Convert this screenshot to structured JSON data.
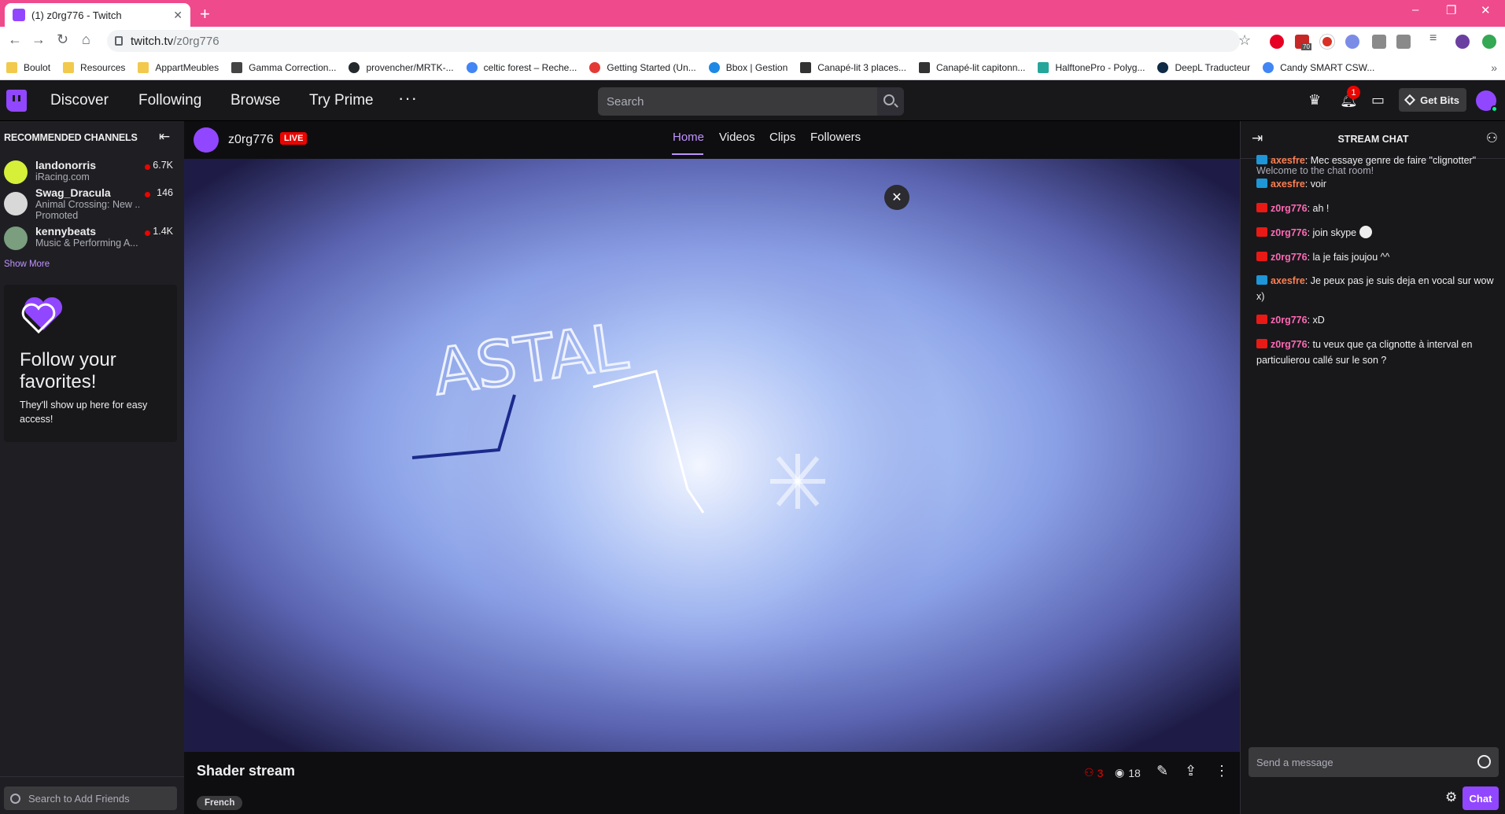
{
  "browser": {
    "tab_title": "(1) z0rg776 - Twitch",
    "tab_close": "✕",
    "new_tab": "+",
    "window_controls": [
      "–",
      "❐",
      "✕"
    ],
    "url_host": "twitch.tv",
    "url_path": "/z0rg776",
    "bookmarks": [
      "Boulot",
      "Resources",
      "AppartMeubles",
      "Gamma Correction...",
      "provencher/MRTK-...",
      "celtic forest – Reche...",
      "Getting Started (Un...",
      "Bbox | Gestion",
      "Canapé-lit 3 places...",
      "Canapé-lit capitonn...",
      "HalftonePro - Polyg...",
      "DeepL Traducteur",
      "Candy SMART CSW..."
    ],
    "ext_badge": "70"
  },
  "nav": {
    "discover": "Discover",
    "following": "Following",
    "browse": "Browse",
    "try_prime": "Try Prime",
    "more": "···",
    "search_placeholder": "Search",
    "notif_count": "1",
    "get_bits": "Get Bits"
  },
  "sidebar": {
    "title": "RECOMMENDED CHANNELS",
    "collapse": "⇤",
    "channels": [
      {
        "name": "landonorris",
        "game": "iRacing.com",
        "viewers": "6.7K",
        "promoted": ""
      },
      {
        "name": "Swag_Dracula",
        "game": "Animal Crossing: New ...",
        "viewers": "146",
        "promoted": "Promoted"
      },
      {
        "name": "kennybeats",
        "game": "Music & Performing A...",
        "viewers": "1.4K",
        "promoted": ""
      }
    ],
    "show_more": "Show More",
    "follow_title": "Follow your favorites!",
    "follow_text": "They'll show up here for easy access!",
    "friends_placeholder": "Search to Add Friends"
  },
  "channel": {
    "name": "z0rg776",
    "live": "LIVE",
    "tabs": [
      "Home",
      "Videos",
      "Clips",
      "Followers"
    ],
    "stream_title": "Shader stream",
    "language": "French",
    "viewers_red": "3",
    "viewers": "18",
    "video_close": "✕",
    "video_text": "ASTAL"
  },
  "chat": {
    "title": "STREAM CHAT",
    "welcome": "Welcome to the chat room!",
    "messages": [
      {
        "user": "axesfre",
        "text": "Mec essaye genre de faire \"clignotter\"",
        "color": "#ff7f50",
        "badge": "vip"
      },
      {
        "user": "axesfre",
        "text": "voir",
        "color": "#ff7f50",
        "badge": "vip"
      },
      {
        "user": "z0rg776",
        "text": "ah !",
        "color": "#ff69b4",
        "badge": "bc"
      },
      {
        "user": "z0rg776",
        "text": "join skype",
        "color": "#ff69b4",
        "badge": "bc"
      },
      {
        "user": "z0rg776",
        "text": "la je fais joujou ^^",
        "color": "#ff69b4",
        "badge": "bc"
      },
      {
        "user": "axesfre",
        "text": "Je peux pas je suis deja en vocal sur wow x)",
        "color": "#ff7f50",
        "badge": "vip"
      },
      {
        "user": "z0rg776",
        "text": "xD",
        "color": "#ff69b4",
        "badge": "bc"
      },
      {
        "user": "z0rg776",
        "text": "tu veux que ça clignotte à interval en particulierou callé sur le son ?",
        "color": "#ff69b4",
        "badge": "bc"
      }
    ],
    "input_placeholder": "Send a message",
    "send": "Chat"
  },
  "colors": {
    "tabbar": "#ef4a8c",
    "twitch_purple": "#9147ff",
    "live_red": "#eb0400"
  }
}
